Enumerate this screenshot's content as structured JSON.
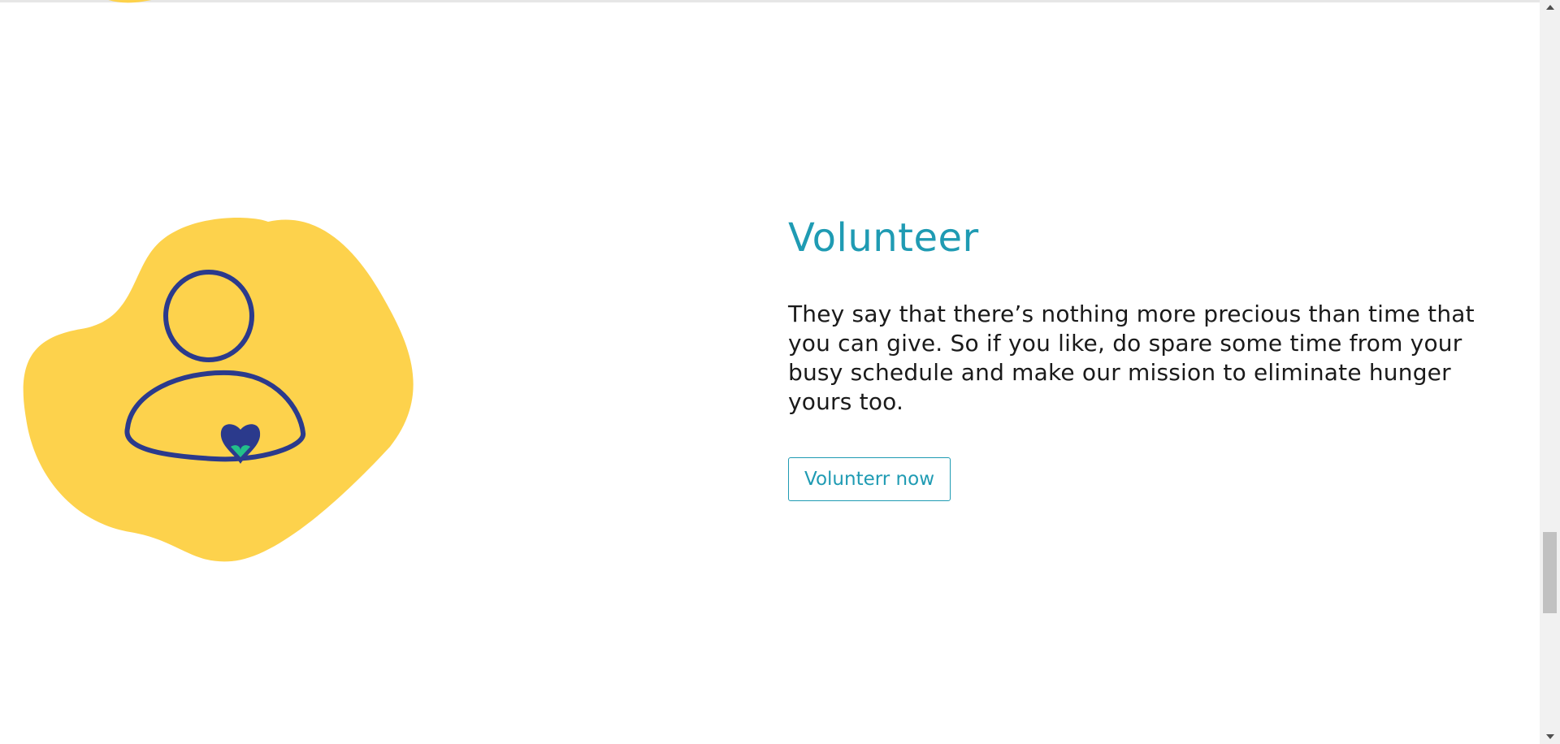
{
  "colors": {
    "accent": "#1f9bb3",
    "blob": "#fdd24c",
    "figure_stroke": "#2b3a8c",
    "heart_inner": "#22c08a",
    "body_text": "#1a1a1a"
  },
  "volunteer_section": {
    "heading": "Volunteer",
    "description": "They say that there’s nothing more precious than time that you can give. So if you like, do spare some time from your busy schedule and make our mission to eliminate hunger yours too.",
    "cta_label": "Volunterr now",
    "illustration_icon": "volunteer-person-heart-icon"
  },
  "scrollbar": {
    "up_icon": "scroll-up-arrow-icon",
    "down_icon": "scroll-down-arrow-icon"
  }
}
